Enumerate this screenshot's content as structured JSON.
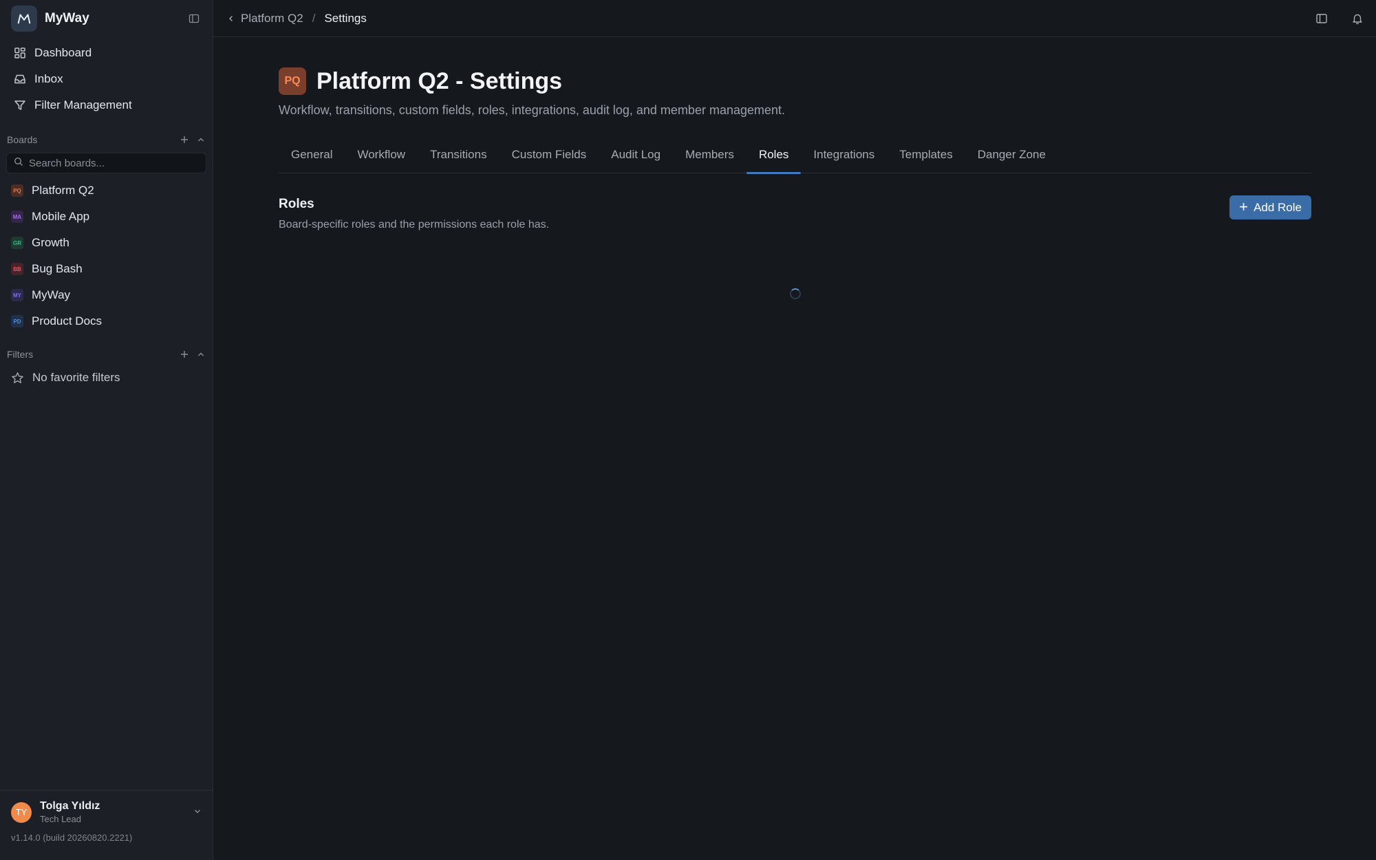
{
  "brand": {
    "name": "MyWay"
  },
  "nav": [
    {
      "label": "Dashboard",
      "icon": "grid-icon"
    },
    {
      "label": "Inbox",
      "icon": "inbox-icon"
    },
    {
      "label": "Filter Management",
      "icon": "filter-icon"
    }
  ],
  "boards": {
    "heading": "Boards",
    "search_placeholder": "Search boards...",
    "items": [
      {
        "label": "Platform Q2",
        "badge": "PQ",
        "color": "#e9763f",
        "bg": "#4a2d24"
      },
      {
        "label": "Mobile App",
        "badge": "MA",
        "color": "#a86ce6",
        "bg": "#33264a"
      },
      {
        "label": "Growth",
        "badge": "GR",
        "color": "#2fbf87",
        "bg": "#1f3a31"
      },
      {
        "label": "Bug Bash",
        "badge": "BB",
        "color": "#e05562",
        "bg": "#46242a"
      },
      {
        "label": "MyWay",
        "badge": "MY",
        "color": "#7a72ea",
        "bg": "#2b2a4c"
      },
      {
        "label": "Product Docs",
        "badge": "PD",
        "color": "#4a8fe0",
        "bg": "#22314a"
      }
    ]
  },
  "filters": {
    "heading": "Filters",
    "empty": "No favorite filters"
  },
  "user": {
    "initials": "TY",
    "name": "Tolga Yıldız",
    "role": "Tech Lead"
  },
  "version": "v1.14.0 (build 20260820.2221)",
  "breadcrumb": {
    "parent": "Platform Q2",
    "separator": "/",
    "current": "Settings"
  },
  "page": {
    "badge": "PQ",
    "title": "Platform Q2 - Settings",
    "subtitle": "Workflow, transitions, custom fields, roles, integrations, audit log, and member management."
  },
  "tabs": [
    "General",
    "Workflow",
    "Transitions",
    "Custom Fields",
    "Audit Log",
    "Members",
    "Roles",
    "Integrations",
    "Templates",
    "Danger Zone"
  ],
  "active_tab": "Roles",
  "section": {
    "title": "Roles",
    "description": "Board-specific roles and the permissions each role has.",
    "add_label": "Add Role"
  },
  "colors": {
    "accent": "#3a6ca8",
    "tab_underline": "#3d7ac1"
  }
}
